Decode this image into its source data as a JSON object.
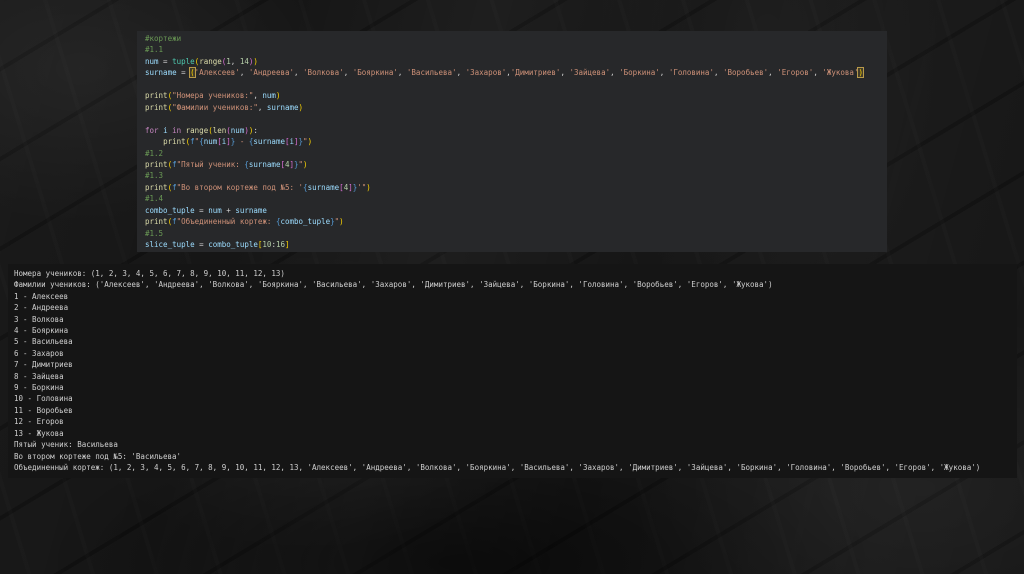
{
  "colors": {
    "desktop_background": "#161616",
    "editor_background": "#27282a",
    "console_background": "#151515",
    "comment": "#6a9955",
    "variable": "#9cdcfe",
    "function": "#dcdcaa",
    "type": "#4ec9b0",
    "keyword": "#c586c0",
    "fstring_brace": "#569cd6",
    "string": "#ce9178",
    "number": "#b5cea8",
    "punctuation": "#d4d4d4",
    "bracket_level1": "#ffd700",
    "bracket_level2": "#da70d6",
    "bracket_match_box": "#b89a4b",
    "console_text": "#cfcfcf"
  },
  "editor": {
    "lines": [
      [
        [
          "#кортежи",
          "c"
        ]
      ],
      [
        [
          "#1.1",
          "c"
        ]
      ],
      [
        [
          "num",
          "v"
        ],
        [
          " = ",
          "o"
        ],
        [
          "tuple",
          "t"
        ],
        [
          "(",
          "b1"
        ],
        [
          "range",
          "f"
        ],
        [
          "(",
          "b2"
        ],
        [
          "1",
          "n"
        ],
        [
          ", ",
          "o"
        ],
        [
          "14",
          "n"
        ],
        [
          ")",
          "b2"
        ],
        [
          ")",
          "b1"
        ]
      ],
      [
        [
          "surname",
          "v"
        ],
        [
          " = ",
          "o"
        ],
        [
          "(",
          "bm"
        ],
        [
          "'Алексеев'",
          "s"
        ],
        [
          ", ",
          "o"
        ],
        [
          "'Андреева'",
          "s"
        ],
        [
          ", ",
          "o"
        ],
        [
          "'Волкова'",
          "s"
        ],
        [
          ", ",
          "o"
        ],
        [
          "'Бояркина'",
          "s"
        ],
        [
          ", ",
          "o"
        ],
        [
          "'Васильева'",
          "s"
        ],
        [
          ", ",
          "o"
        ],
        [
          "'Захаров'",
          "s"
        ],
        [
          ",",
          "o"
        ],
        [
          "'Димитриев'",
          "s"
        ],
        [
          ", ",
          "o"
        ],
        [
          "'Зайцева'",
          "s"
        ],
        [
          ", ",
          "o"
        ],
        [
          "'Боркина'",
          "s"
        ],
        [
          ", ",
          "o"
        ],
        [
          "'Головина'",
          "s"
        ],
        [
          ", ",
          "o"
        ],
        [
          "'Воробьев'",
          "s"
        ],
        [
          ", ",
          "o"
        ],
        [
          "'Егоров'",
          "s"
        ],
        [
          ", ",
          "o"
        ],
        [
          "'Жукова'",
          "s"
        ],
        [
          ")",
          "bm"
        ]
      ],
      [],
      [
        [
          "print",
          "f"
        ],
        [
          "(",
          "b1"
        ],
        [
          "\"Номера учеников:\"",
          "s"
        ],
        [
          ", ",
          "o"
        ],
        [
          "num",
          "v"
        ],
        [
          ")",
          "b1"
        ]
      ],
      [
        [
          "print",
          "f"
        ],
        [
          "(",
          "b1"
        ],
        [
          "\"Фамилии учеников:\"",
          "s"
        ],
        [
          ", ",
          "o"
        ],
        [
          "surname",
          "v"
        ],
        [
          ")",
          "b1"
        ]
      ],
      [],
      [
        [
          "for",
          "k"
        ],
        [
          " ",
          "o"
        ],
        [
          "i",
          "v"
        ],
        [
          " ",
          "o"
        ],
        [
          "in",
          "k"
        ],
        [
          " ",
          "o"
        ],
        [
          "range",
          "f"
        ],
        [
          "(",
          "b1"
        ],
        [
          "len",
          "f"
        ],
        [
          "(",
          "b2"
        ],
        [
          "num",
          "v"
        ],
        [
          ")",
          "b2"
        ],
        [
          ")",
          "b1"
        ],
        [
          ":",
          "o"
        ]
      ],
      [
        [
          "    ",
          "o"
        ],
        [
          "print",
          "f"
        ],
        [
          "(",
          "b1"
        ],
        [
          "f",
          "d"
        ],
        [
          "\"",
          "s"
        ],
        [
          "{",
          "d"
        ],
        [
          "num",
          "v"
        ],
        [
          "[",
          "b2"
        ],
        [
          "i",
          "v"
        ],
        [
          "]",
          "b2"
        ],
        [
          "}",
          "d"
        ],
        [
          " - ",
          "s"
        ],
        [
          "{",
          "d"
        ],
        [
          "surname",
          "v"
        ],
        [
          "[",
          "b2"
        ],
        [
          "i",
          "v"
        ],
        [
          "]",
          "b2"
        ],
        [
          "}",
          "d"
        ],
        [
          "\"",
          "s"
        ],
        [
          ")",
          "b1"
        ]
      ],
      [
        [
          "#1.2",
          "c"
        ]
      ],
      [
        [
          "print",
          "f"
        ],
        [
          "(",
          "b1"
        ],
        [
          "f",
          "d"
        ],
        [
          "\"Пятый ученик: ",
          "s"
        ],
        [
          "{",
          "d"
        ],
        [
          "surname",
          "v"
        ],
        [
          "[",
          "b2"
        ],
        [
          "4",
          "n"
        ],
        [
          "]",
          "b2"
        ],
        [
          "}",
          "d"
        ],
        [
          "\"",
          "s"
        ],
        [
          ")",
          "b1"
        ]
      ],
      [
        [
          "#1.3",
          "c"
        ]
      ],
      [
        [
          "print",
          "f"
        ],
        [
          "(",
          "b1"
        ],
        [
          "f",
          "d"
        ],
        [
          "\"Во втором кортеже под №5: '",
          "s"
        ],
        [
          "{",
          "d"
        ],
        [
          "surname",
          "v"
        ],
        [
          "[",
          "b2"
        ],
        [
          "4",
          "n"
        ],
        [
          "]",
          "b2"
        ],
        [
          "}",
          "d"
        ],
        [
          "'\"",
          "s"
        ],
        [
          ")",
          "b1"
        ]
      ],
      [
        [
          "#1.4",
          "c"
        ]
      ],
      [
        [
          "combo_tuple",
          "v"
        ],
        [
          " = ",
          "o"
        ],
        [
          "num",
          "v"
        ],
        [
          " + ",
          "o"
        ],
        [
          "surname",
          "v"
        ]
      ],
      [
        [
          "print",
          "f"
        ],
        [
          "(",
          "b1"
        ],
        [
          "f",
          "d"
        ],
        [
          "\"Объединенный кортеж: ",
          "s"
        ],
        [
          "{",
          "d"
        ],
        [
          "combo_tuple",
          "v"
        ],
        [
          "}",
          "d"
        ],
        [
          "\"",
          "s"
        ],
        [
          ")",
          "b1"
        ]
      ],
      [
        [
          "#1.5",
          "c"
        ]
      ],
      [
        [
          "slice_tuple",
          "v"
        ],
        [
          " = ",
          "o"
        ],
        [
          "combo_tuple",
          "v"
        ],
        [
          "[",
          "b1"
        ],
        [
          "10",
          "n"
        ],
        [
          ":",
          "o"
        ],
        [
          "16",
          "n"
        ],
        [
          "]",
          "b1"
        ]
      ]
    ]
  },
  "console": {
    "lines": [
      "Номера учеников: (1, 2, 3, 4, 5, 6, 7, 8, 9, 10, 11, 12, 13)",
      "Фамилии учеников: ('Алексеев', 'Андреева', 'Волкова', 'Бояркина', 'Васильева', 'Захаров', 'Димитриев', 'Зайцева', 'Боркина', 'Головина', 'Воробьев', 'Егоров', 'Жукова')",
      "1 - Алексеев",
      "2 - Андреева",
      "3 - Волкова",
      "4 - Бояркина",
      "5 - Васильева",
      "6 - Захаров",
      "7 - Димитриев",
      "8 - Зайцева",
      "9 - Боркина",
      "10 - Головина",
      "11 - Воробьев",
      "12 - Егоров",
      "13 - Жукова",
      "Пятый ученик: Васильева",
      "Во втором кортеже под №5: 'Васильева'",
      "Объединенный кортеж: (1, 2, 3, 4, 5, 6, 7, 8, 9, 10, 11, 12, 13, 'Алексеев', 'Андреева', 'Волкова', 'Бояркина', 'Васильева', 'Захаров', 'Димитриев', 'Зайцева', 'Боркина', 'Головина', 'Воробьев', 'Егоров', 'Жукова')"
    ]
  }
}
